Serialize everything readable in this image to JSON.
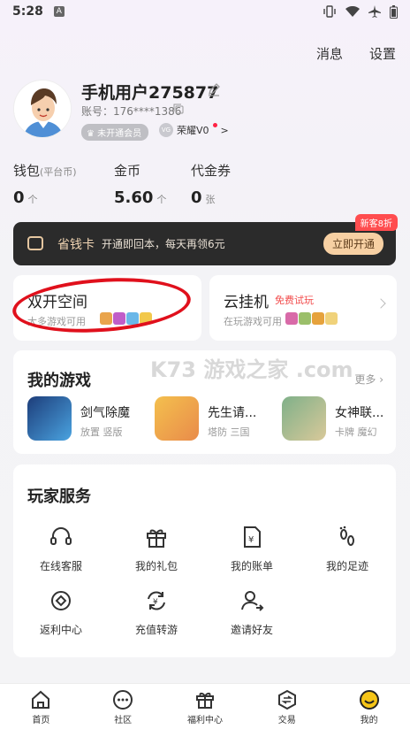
{
  "status_bar": {
    "time": "5:28",
    "notif_icon": "A"
  },
  "header": {
    "messages": "消息",
    "settings": "设置"
  },
  "profile": {
    "username": "手机用户275877",
    "account": "账号：176****1386",
    "member_badge": "未开通会员",
    "rank_badge": "VG",
    "rank_label": "荣耀V0",
    "rank_chevron": ">"
  },
  "wallet": {
    "items": [
      {
        "label": "钱包",
        "sub": "(平台币)",
        "value": "0",
        "unit": "个"
      },
      {
        "label": "金币",
        "sub": "",
        "value": "5.60",
        "unit": "个"
      },
      {
        "label": "代金券",
        "sub": "",
        "value": "0",
        "unit": "张"
      }
    ]
  },
  "vip_card": {
    "title": "省钱卡",
    "desc": "开通即回本，每天再领6元",
    "button": "立即开通",
    "badge": "新客8折"
  },
  "dual_space": {
    "title": "双开空间",
    "subtitle": "大多游戏可用"
  },
  "cloud": {
    "title": "云挂机",
    "tag": "免费试玩",
    "subtitle": "在玩游戏可用"
  },
  "watermark": "K73 游戏之家 .com",
  "my_games": {
    "title": "我的游戏",
    "more": "更多",
    "games": [
      {
        "name": "剑气除魔",
        "tags": "放置 竖版"
      },
      {
        "name": "先生请...",
        "tags": "塔防 三国"
      },
      {
        "name": "女神联...",
        "tags": "卡牌 魔幻"
      }
    ]
  },
  "services": {
    "title": "玩家服务",
    "items": [
      {
        "label": "在线客服",
        "icon": "headset-icon"
      },
      {
        "label": "我的礼包",
        "icon": "gift-icon"
      },
      {
        "label": "我的账单",
        "icon": "bill-icon"
      },
      {
        "label": "我的足迹",
        "icon": "footprint-icon"
      },
      {
        "label": "返利中心",
        "icon": "rebate-icon"
      },
      {
        "label": "充值转游",
        "icon": "transfer-icon"
      },
      {
        "label": "邀请好友",
        "icon": "invite-icon"
      }
    ]
  },
  "tabbar": {
    "items": [
      {
        "label": "首页",
        "icon": "home-icon"
      },
      {
        "label": "社区",
        "icon": "community-icon"
      },
      {
        "label": "福利中心",
        "icon": "welfare-icon"
      },
      {
        "label": "交易",
        "icon": "trade-icon"
      },
      {
        "label": "我的",
        "icon": "me-icon"
      }
    ]
  },
  "colors": {
    "accent_red": "#e0101c",
    "vip_bg": "#2b2b2b",
    "vip_button": "#f7d0a3",
    "new_badge": "#ff4d4f"
  }
}
